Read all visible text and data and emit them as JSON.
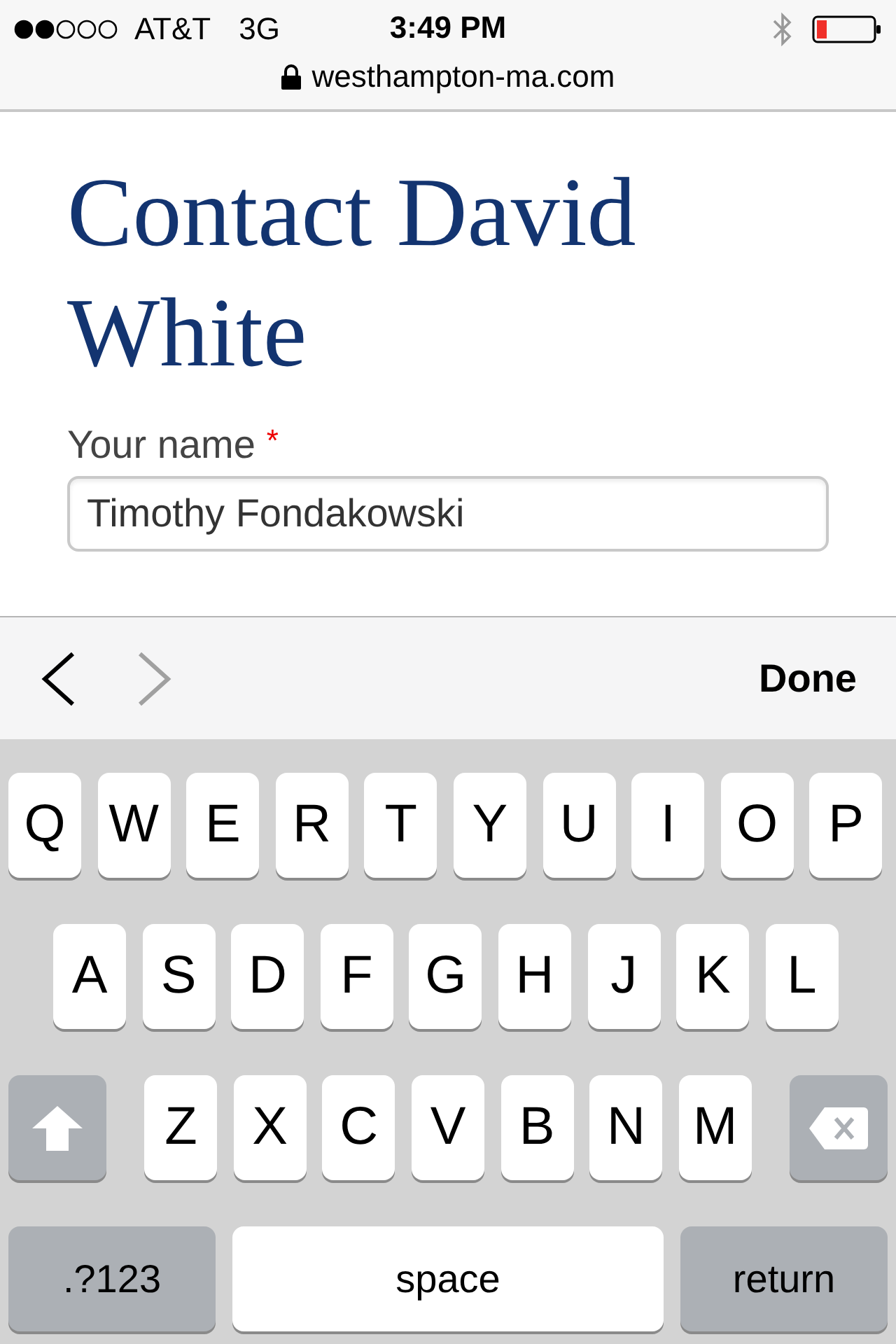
{
  "status_bar": {
    "carrier": "AT&T",
    "network": "3G",
    "time": "3:49 PM",
    "url": "westhampton-ma.com"
  },
  "heading": "Contact David White",
  "name_field": {
    "label": "Your name",
    "required_mark": "*",
    "value": "Timothy Fondakowski"
  },
  "accessory_bar": {
    "previous": {
      "disabled": false
    },
    "next": {
      "disabled": true
    },
    "done": "Done"
  },
  "keyboard": {
    "letter_rows": [
      [
        "Q",
        "W",
        "E",
        "R",
        "T",
        "Y",
        "U",
        "I",
        "O",
        "P"
      ],
      [
        "A",
        "S",
        "D",
        "F",
        "G",
        "H",
        "J",
        "K",
        "L"
      ],
      [
        "Z",
        "X",
        "C",
        "V",
        "B",
        "N",
        "M"
      ]
    ],
    "mode_key": ".?123",
    "space_key": "space",
    "return_key": "return"
  }
}
